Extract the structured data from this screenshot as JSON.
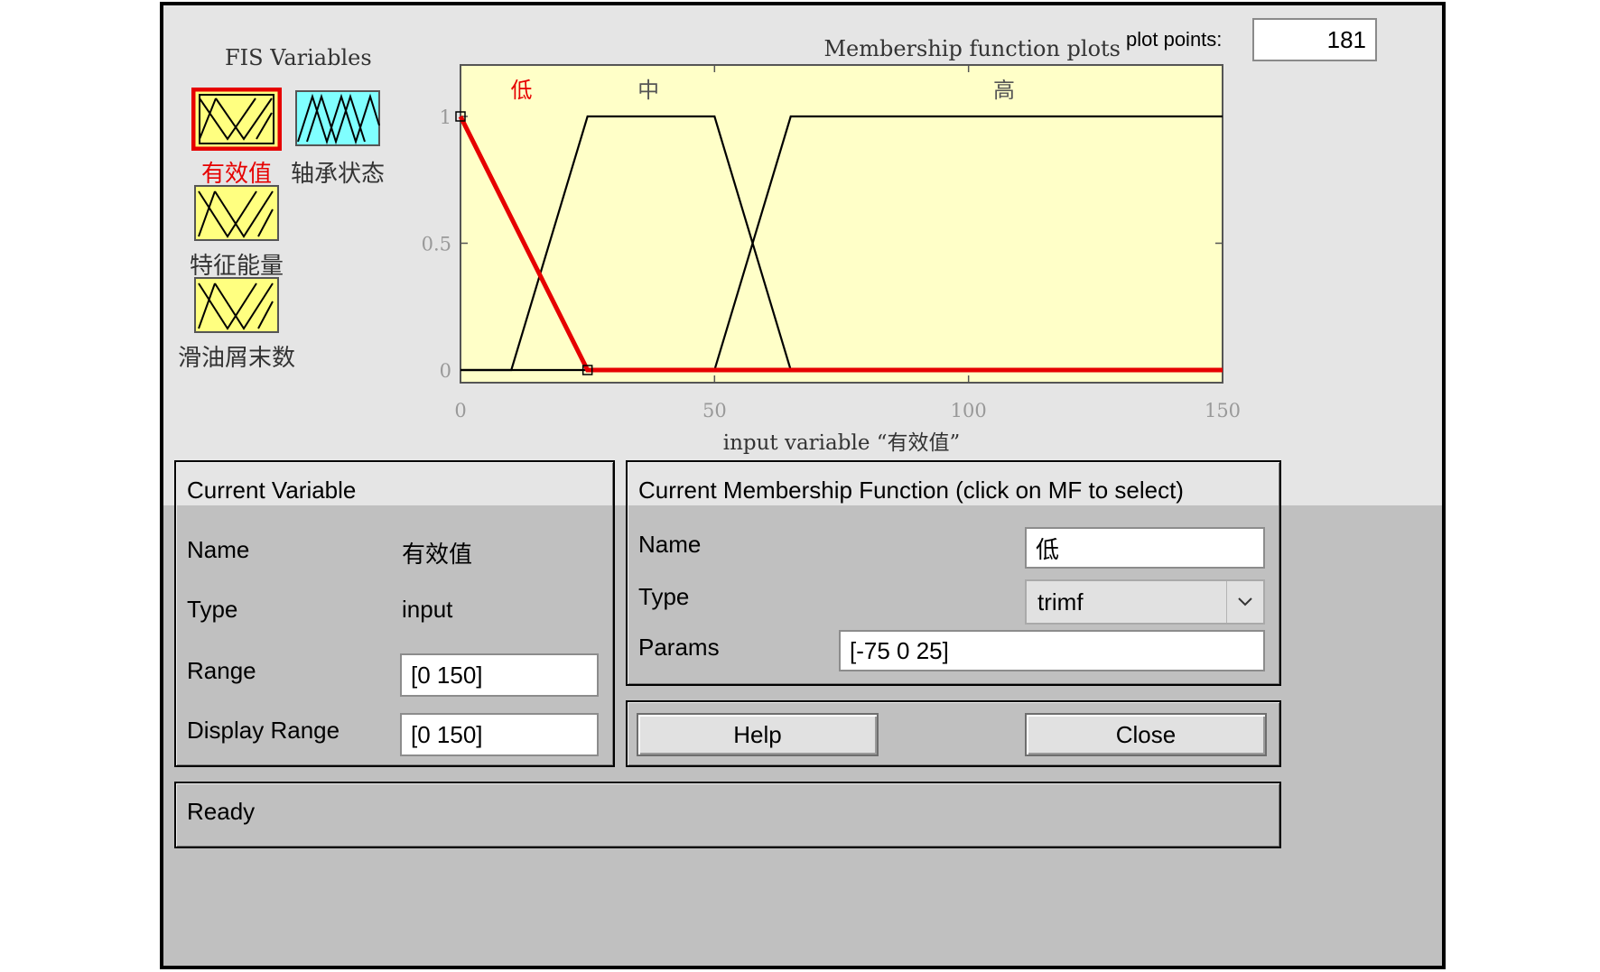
{
  "fis_variables": {
    "title": "FIS Variables",
    "items": [
      {
        "label": "有效值",
        "kind": "input",
        "selected": true
      },
      {
        "label": "轴承状态",
        "kind": "output",
        "selected": false
      },
      {
        "label": "特征能量",
        "kind": "input",
        "selected": false
      },
      {
        "label": "滑油屑末数",
        "kind": "input",
        "selected": false
      }
    ]
  },
  "plot": {
    "title": "Membership function plots",
    "plot_points_label": "plot points:",
    "plot_points_value": "181",
    "xlabel": "input variable “有效值”",
    "mf_labels": [
      "低",
      "中",
      "高"
    ]
  },
  "chart_data": {
    "type": "line",
    "xlim": [
      0,
      150
    ],
    "ylim": [
      0,
      1
    ],
    "x_ticks": [
      0,
      50,
      100,
      150
    ],
    "y_ticks": [
      0,
      0.5,
      1
    ],
    "y_tick_labels": [
      "0",
      "0.5",
      "1"
    ],
    "xlabel": "input variable “有效值”",
    "series": [
      {
        "name": "低",
        "selected": true,
        "color": "#e60000",
        "x": [
          0,
          25,
          150
        ],
        "y": [
          1,
          0,
          0
        ]
      },
      {
        "name": "中",
        "selected": false,
        "color": "#000000",
        "x": [
          0,
          10,
          25,
          50,
          65,
          150
        ],
        "y": [
          0,
          0,
          1,
          1,
          0,
          0
        ]
      },
      {
        "name": "高",
        "selected": false,
        "color": "#000000",
        "x": [
          0,
          50,
          65,
          150
        ],
        "y": [
          0,
          0,
          1,
          1
        ]
      }
    ],
    "background": "#ffffc8"
  },
  "current_variable": {
    "title": "Current Variable",
    "name_label": "Name",
    "name_value": "有效值",
    "type_label": "Type",
    "type_value": "input",
    "range_label": "Range",
    "range_value": "[0 150]",
    "display_range_label": "Display Range",
    "display_range_value": "[0 150]"
  },
  "current_mf": {
    "title": "Current Membership Function (click on MF to select)",
    "name_label": "Name",
    "name_value": "低",
    "type_label": "Type",
    "type_value": "trimf",
    "params_label": "Params",
    "params_value": "[-75 0 25]"
  },
  "buttons": {
    "help": "Help",
    "close": "Close"
  },
  "status": {
    "text": "Ready"
  },
  "colors": {
    "selected": "#e60000",
    "input_icon": "#ffff80",
    "output_icon": "#80ffff"
  }
}
